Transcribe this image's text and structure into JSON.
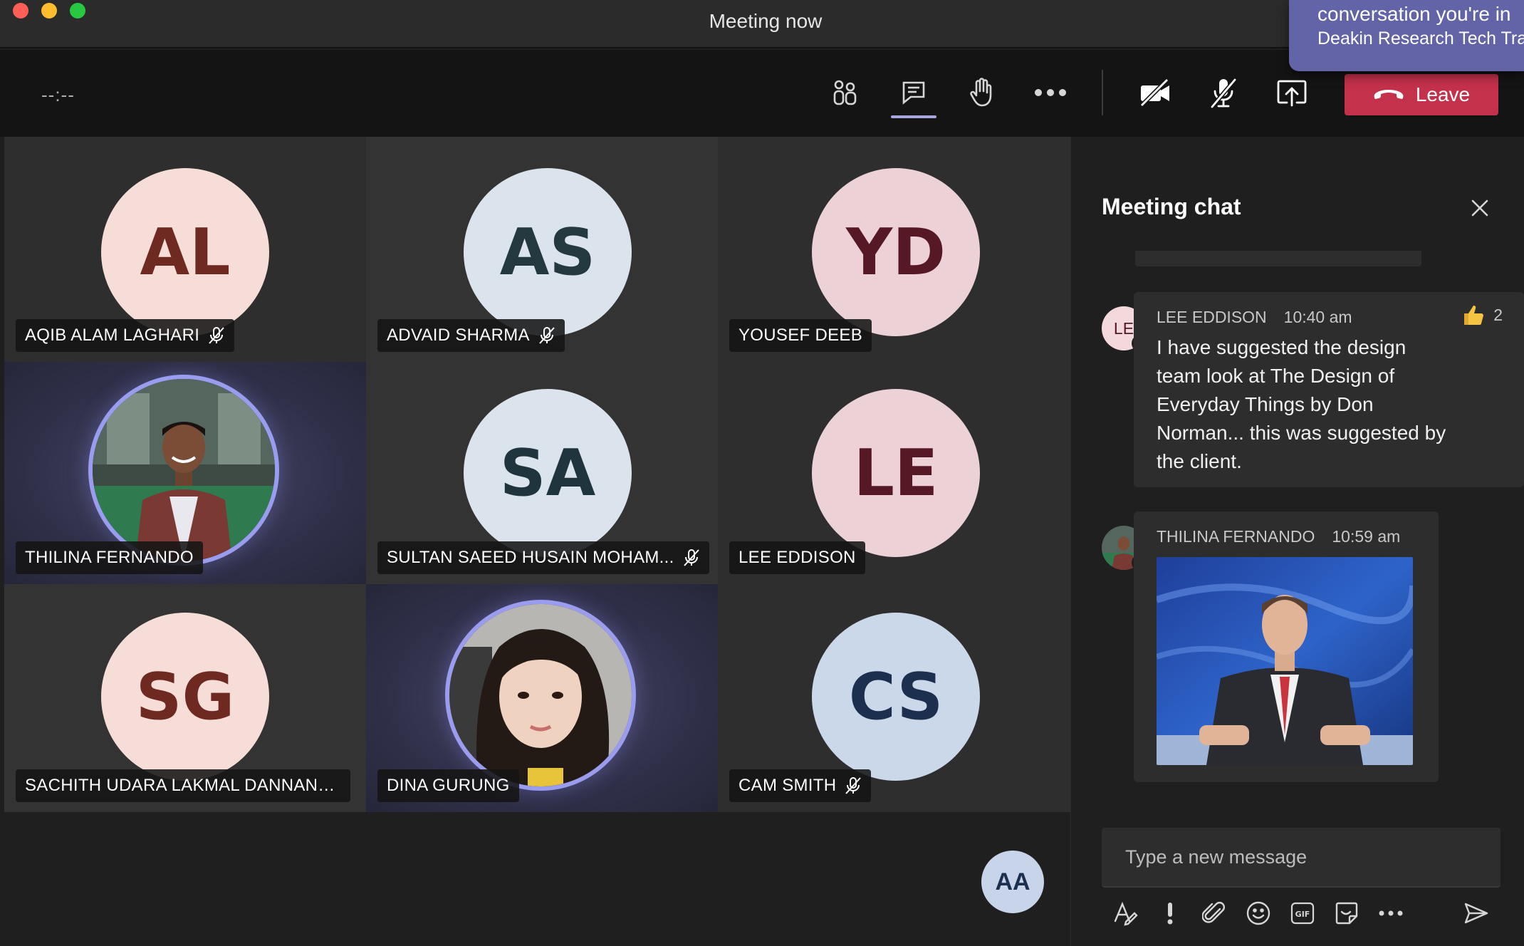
{
  "window": {
    "title": "Meeting now"
  },
  "notification": {
    "line1": "conversation you're in",
    "line2": "Deakin Research Tech Tran"
  },
  "toolbar": {
    "timer": "--:--",
    "leave_label": "Leave",
    "icons": [
      "participants-icon",
      "chat-icon",
      "raise-hand-icon",
      "more-options-icon",
      "camera-off-icon",
      "mic-off-icon",
      "share-screen-icon"
    ]
  },
  "participants": [
    {
      "initials": "AL",
      "name": "AQIB ALAM LAGHARI",
      "muted": true,
      "bg": "#f6ddd7",
      "fg": "#6e2a20"
    },
    {
      "initials": "AS",
      "name": "ADVAID SHARMA",
      "muted": true,
      "bg": "#dbe4ec",
      "fg": "#23383f"
    },
    {
      "initials": "YD",
      "name": "YOUSEF DEEB",
      "muted": false,
      "bg": "#ecd2d6",
      "fg": "#571826"
    },
    {
      "initials": "",
      "name": "THILINA FERNANDO",
      "muted": false,
      "video": true
    },
    {
      "initials": "SA",
      "name": "SULTAN SAEED HUSAIN MOHAM...",
      "muted": true,
      "bg": "#dbe4ec",
      "fg": "#1f343c"
    },
    {
      "initials": "LE",
      "name": "LEE EDDISON",
      "muted": false,
      "bg": "#ecd2d6",
      "fg": "#571826"
    },
    {
      "initials": "SG",
      "name": "SACHITH UDARA LAKMAL DANNANG...",
      "muted": false,
      "bg": "#f6ddd7",
      "fg": "#6e2a20"
    },
    {
      "initials": "",
      "name": "DINA GURUNG",
      "muted": false,
      "video": true
    },
    {
      "initials": "CS",
      "name": "CAM SMITH",
      "muted": true,
      "bg": "#cbd8ea",
      "fg": "#1d2f4e"
    }
  ],
  "self": {
    "initials": "AA"
  },
  "chat": {
    "title": "Meeting chat",
    "messages": [
      {
        "avatar": "LE",
        "author": "LEE EDDISON",
        "time": "10:40 am",
        "reaction_count": "2",
        "text": "I have suggested the design team look at The Design of Everyday Things by Don Norman... this was suggested by the client."
      },
      {
        "author": "THILINA FERNANDO",
        "time": "10:59 am",
        "attachment": "gif"
      }
    ],
    "compose_placeholder": "Type a new message",
    "gif_label": "GIF"
  },
  "colors": {
    "accent": "#6264a7",
    "leave": "#c4314b",
    "video_ring": "#9a9cf0"
  }
}
